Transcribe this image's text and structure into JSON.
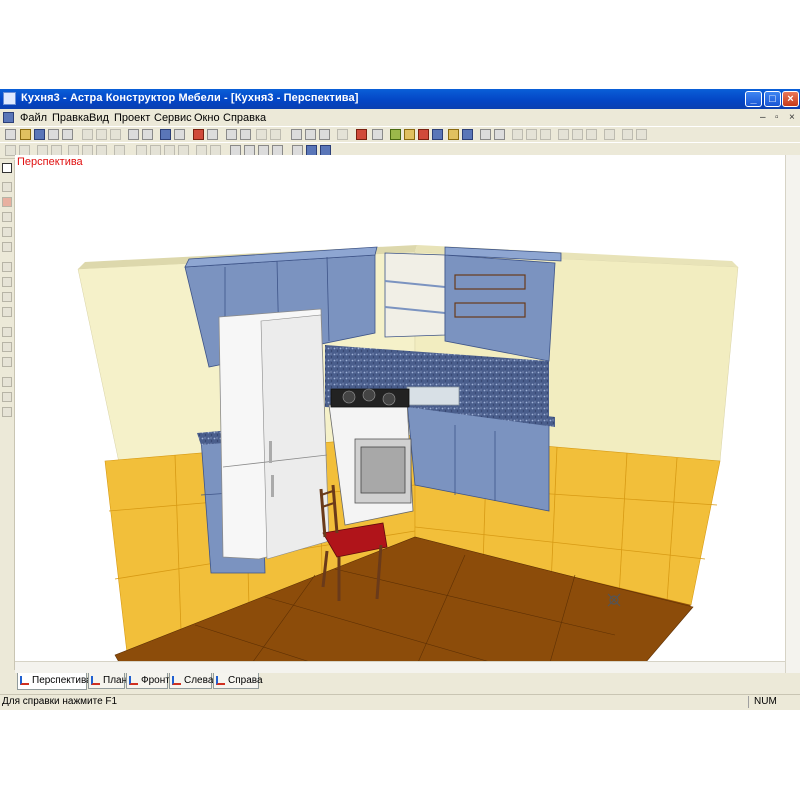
{
  "window": {
    "title": "Кухня3 - Астра Конструктор Мебели - [Кухня3 - Перспектива]",
    "minimize": "_",
    "maximize": "□",
    "close": "×"
  },
  "menu": {
    "items": [
      "Файл",
      "Правка",
      "Вид",
      "Проект",
      "Сервис",
      "Окно",
      "Справка"
    ],
    "doc_controls": [
      "–",
      "▫",
      "×"
    ]
  },
  "view": {
    "label": "Перспектива"
  },
  "tabs": [
    {
      "label": "Перспектива",
      "active": true
    },
    {
      "label": "План",
      "active": false
    },
    {
      "label": "Фронт",
      "active": false
    },
    {
      "label": "Слева",
      "active": false
    },
    {
      "label": "Справа",
      "active": false
    }
  ],
  "status": {
    "help_text": "Для справки нажмите F1",
    "num_indicator": "NUM"
  },
  "colors": {
    "title_blue": "#0a5fd8",
    "view_label_red": "#e01010",
    "cabinet_blue": "#7b93c0",
    "wall_cream": "#f5f0c8",
    "tile_yellow": "#f2bf3a",
    "floor_brown": "#8a4a08"
  },
  "icons": [
    "app-icon",
    "new-file-icon",
    "open-file-icon",
    "save-icon",
    "print-icon",
    "cut-icon",
    "copy-icon",
    "paste-icon",
    "undo-icon",
    "redo-icon",
    "zoom-in-icon",
    "zoom-out-icon",
    "rotate-icon",
    "select-arrow-icon",
    "move-cursor-icon"
  ]
}
